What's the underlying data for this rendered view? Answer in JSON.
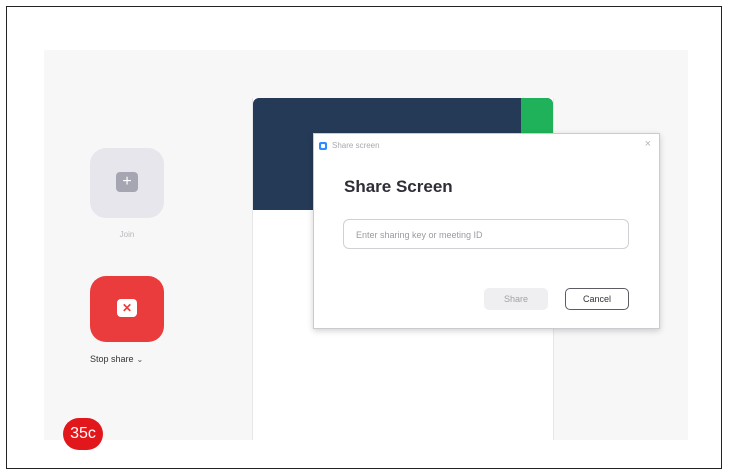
{
  "left_panel": {
    "join": {
      "icon": "plus-icon",
      "label": "Join"
    },
    "stop_share": {
      "icon": "close-icon",
      "label": "Stop share",
      "chevron": "⌄"
    }
  },
  "dialog": {
    "window_title": "Share screen",
    "heading": "Share Screen",
    "input": {
      "value": "",
      "placeholder": "Enter sharing key or meeting ID"
    },
    "share_button": "Share",
    "cancel_button": "Cancel",
    "close_glyph": "×"
  },
  "badge": {
    "text": "35c",
    "color": "#e2171b"
  },
  "colors": {
    "stop_share": "#ea3c3c",
    "banner": "#243a56",
    "banner_accent": "#1fb25a",
    "app_icon": "#2d8cff"
  }
}
